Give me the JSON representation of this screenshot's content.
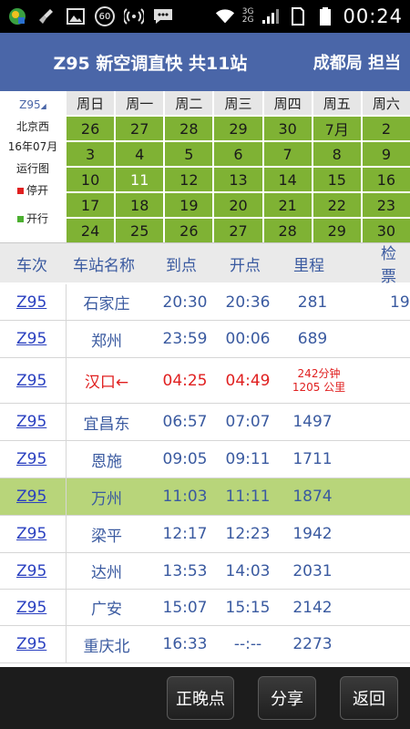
{
  "status_bar": {
    "battery_badge": "60",
    "network_top": "3G",
    "network_bottom": "2G",
    "time": "00:24"
  },
  "title_bar": {
    "title": "Z95 新空调直快 共11站",
    "right": "成都局 担当"
  },
  "calendar": {
    "train": "Z95",
    "origin": "北京西",
    "month": "16年07月",
    "caption": "运行图",
    "legend_stopped": "停开",
    "legend_running": "开行",
    "weekdays": [
      "周日",
      "周一",
      "周二",
      "周三",
      "周四",
      "周五",
      "周六"
    ],
    "weeks": [
      [
        "26",
        "27",
        "28",
        "29",
        "30",
        "7月",
        "2"
      ],
      [
        "3",
        "4",
        "5",
        "6",
        "7",
        "8",
        "9"
      ],
      [
        "10",
        "11",
        "12",
        "13",
        "14",
        "15",
        "16"
      ],
      [
        "17",
        "18",
        "19",
        "20",
        "21",
        "22",
        "23"
      ],
      [
        "24",
        "25",
        "26",
        "27",
        "28",
        "29",
        "30"
      ]
    ],
    "today": "11",
    "colors": {
      "running": "#7fb234",
      "stopped": "#e02020",
      "header": "#e6e6e6"
    }
  },
  "table": {
    "headers": [
      "车次",
      "车站名称",
      "到点",
      "开点",
      "里程",
      "检票"
    ],
    "rows": [
      {
        "train": "Z95",
        "station": "石家庄",
        "arrive": "20:30",
        "depart": "20:36",
        "distance": "281",
        "gate": "19"
      },
      {
        "train": "Z95",
        "station": "郑州",
        "arrive": "23:59",
        "depart": "00:06",
        "distance": "689",
        "gate": ""
      },
      {
        "train": "Z95",
        "station": "汉口←",
        "arrive": "04:25",
        "depart": "04:49",
        "distance": "",
        "gate": "",
        "stop_note": [
          "242分钟",
          "1205 公里"
        ]
      },
      {
        "train": "Z95",
        "station": "宜昌东",
        "arrive": "06:57",
        "depart": "07:07",
        "distance": "1497",
        "gate": ""
      },
      {
        "train": "Z95",
        "station": "恩施",
        "arrive": "09:05",
        "depart": "09:11",
        "distance": "1711",
        "gate": ""
      },
      {
        "train": "Z95",
        "station": "万州",
        "arrive": "11:03",
        "depart": "11:11",
        "distance": "1874",
        "gate": ""
      },
      {
        "train": "Z95",
        "station": "梁平",
        "arrive": "12:17",
        "depart": "12:23",
        "distance": "1942",
        "gate": ""
      },
      {
        "train": "Z95",
        "station": "达州",
        "arrive": "13:53",
        "depart": "14:03",
        "distance": "2031",
        "gate": ""
      },
      {
        "train": "Z95",
        "station": "广安",
        "arrive": "15:07",
        "depart": "15:15",
        "distance": "2142",
        "gate": ""
      },
      {
        "train": "Z95",
        "station": "重庆北",
        "arrive": "16:33",
        "depart": "--:--",
        "distance": "2273",
        "gate": ""
      }
    ],
    "highlight_station": "万州",
    "colors": {
      "header_text": "#3a5aa0",
      "highlight": "#b8d57a",
      "link": "#2a40c0",
      "stop": "#e02020"
    }
  },
  "bottom_bar": {
    "ontime_label": "正晚点",
    "share_label": "分享",
    "back_label": "返回"
  }
}
